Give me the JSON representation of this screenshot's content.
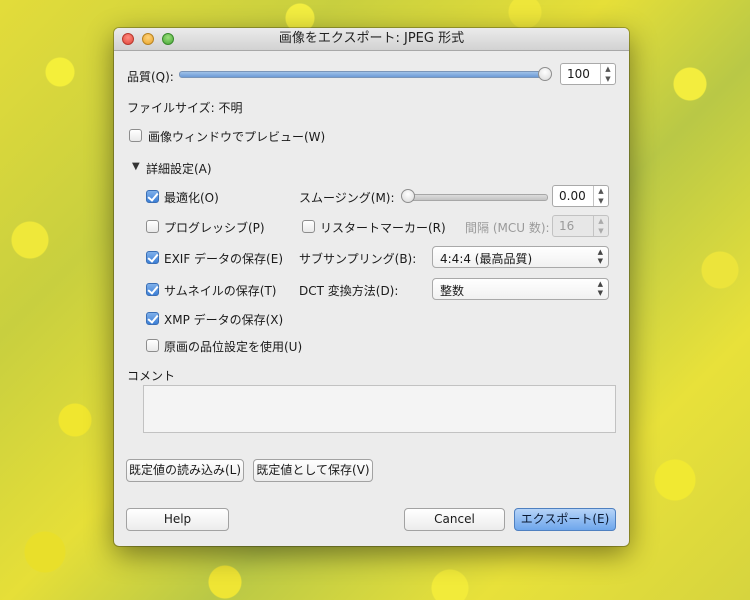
{
  "window": {
    "title": "画像をエクスポート: JPEG 形式"
  },
  "quality": {
    "label": "品質(Q):",
    "value": "100",
    "level": 1.0
  },
  "file_size": {
    "label": "ファイルサイズ: 不明"
  },
  "preview": {
    "label": "画像ウィンドウでプレビュー(W)",
    "checked": false
  },
  "advanced": {
    "label": "詳細設定(A)",
    "optimize": {
      "label": "最適化(O)",
      "checked": true
    },
    "progressive": {
      "label": "プログレッシブ(P)",
      "checked": false
    },
    "exif": {
      "label": "EXIF データの保存(E)",
      "checked": true
    },
    "thumbnail": {
      "label": "サムネイルの保存(T)",
      "checked": true
    },
    "xmp": {
      "label": "XMP データの保存(X)",
      "checked": true
    },
    "original_quality": {
      "label": "原画の品位設定を使用(U)",
      "checked": false
    },
    "smoothing": {
      "label": "スムージング(M):",
      "value": "0.00",
      "level": 0.0
    },
    "restart": {
      "label": "リスタートマーカー(R)",
      "checked": false
    },
    "interval": {
      "label": "間隔 (MCU 数):",
      "value": "16"
    },
    "subsampling": {
      "label": "サブサンプリング(B):",
      "value": "4:4:4 (最高品質)"
    },
    "dct": {
      "label": "DCT 変換方法(D):",
      "value": "整数"
    }
  },
  "comment": {
    "label": "コメント",
    "value": ""
  },
  "buttons": {
    "load_defaults": "既定値の読み込み(L)",
    "save_defaults": "既定値として保存(V)",
    "help": "Help",
    "cancel": "Cancel",
    "export": "エクスポート(E)"
  },
  "colors": {
    "accent": "#3c7fd6",
    "primary_button": "#6ea6ec"
  }
}
